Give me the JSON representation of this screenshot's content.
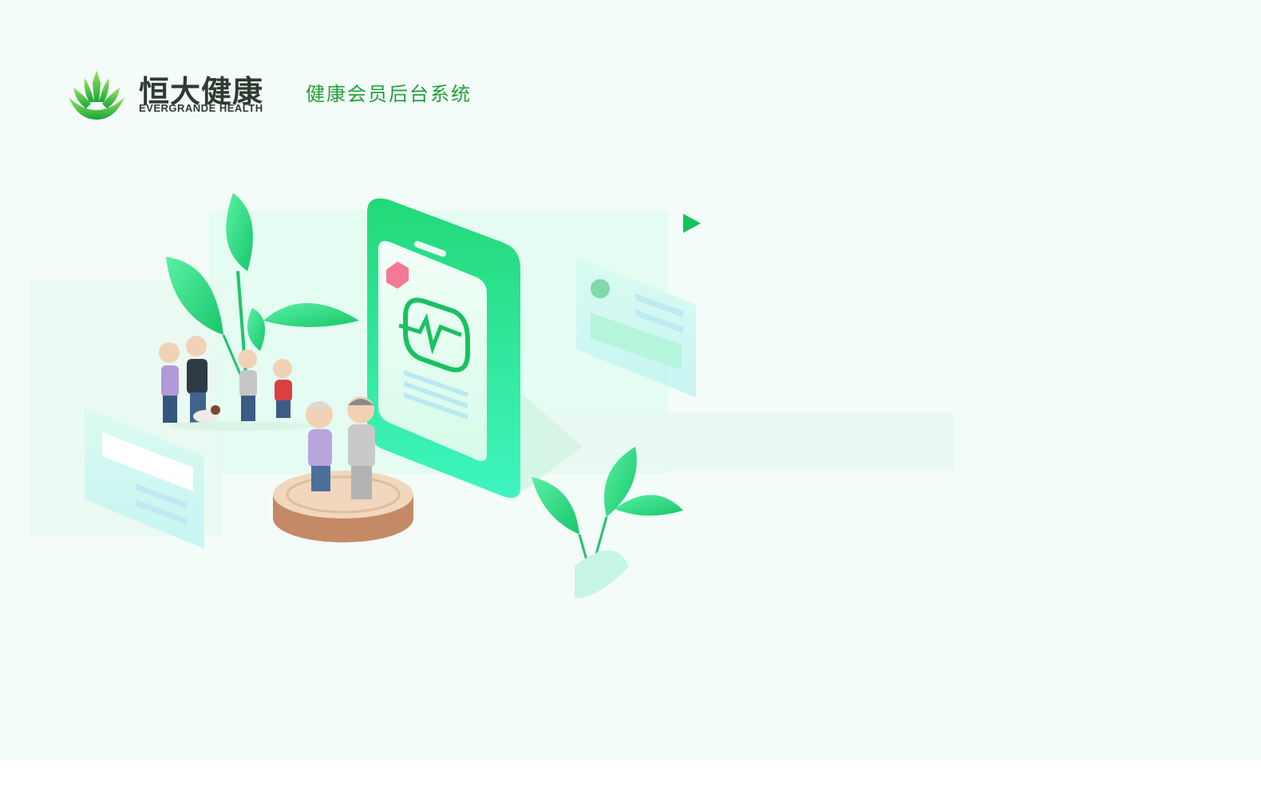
{
  "header": {
    "brand_name_cn": "恒大健康",
    "brand_name_en": "EVERGRANDE HEALTH",
    "system_title": "健康会员后台系统"
  },
  "colors": {
    "background": "#f3fcf8",
    "brand_green": "#21a038",
    "phone_green": "#1fd97a",
    "text_dark": "#2f3a33"
  },
  "illustration": {
    "icons": [
      "logo-icon",
      "phone-icon",
      "heartbeat-icon",
      "badge-icon",
      "play-icon",
      "leaf-icon",
      "family-figures",
      "elderly-couple",
      "wood-pedestal"
    ]
  }
}
